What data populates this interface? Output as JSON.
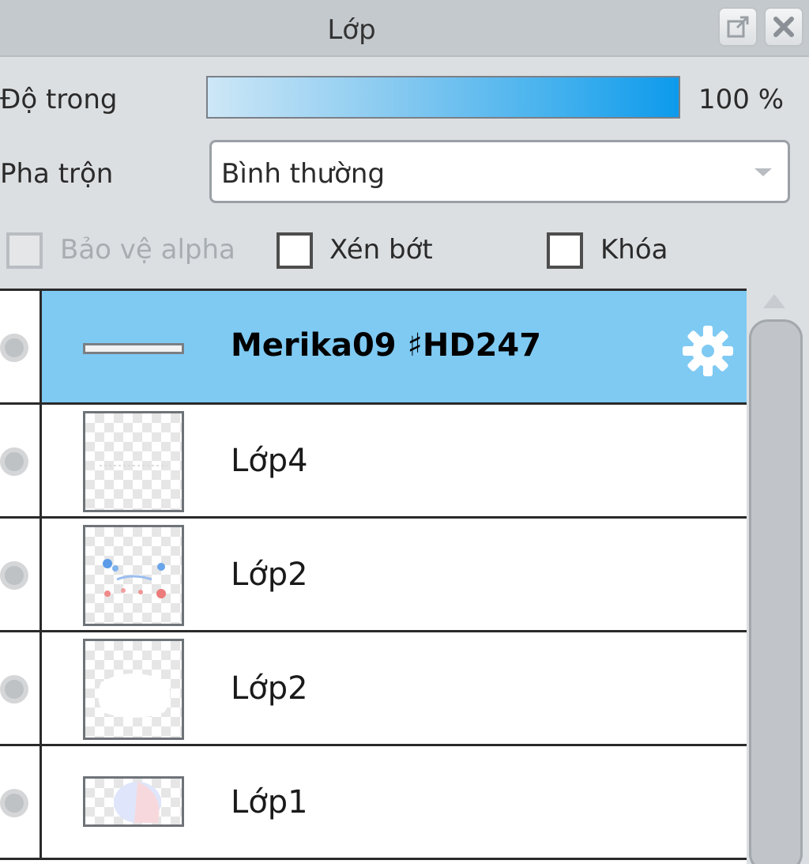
{
  "panel": {
    "title": "Lớp",
    "popout_icon": "popout-icon",
    "close_icon": "close-icon"
  },
  "opacity": {
    "label": "Độ trong",
    "value_text": "100 %",
    "fraction": 1.0
  },
  "blend": {
    "label": "Pha trộn",
    "selected": "Bình thường"
  },
  "options": {
    "protect_alpha": {
      "label": "Bảo vệ alpha",
      "checked": false,
      "disabled": true
    },
    "clip": {
      "label": "Xén bớt",
      "checked": false
    },
    "lock": {
      "label": "Khóa",
      "checked": false
    }
  },
  "layers": [
    {
      "name": "Merika09 ♯HD247",
      "selected": true,
      "gear_icon": "gear-icon"
    },
    {
      "name": "Lớp4",
      "selected": false
    },
    {
      "name": "Lớp2",
      "selected": false
    },
    {
      "name": "Lớp2",
      "selected": false
    },
    {
      "name": "Lớp1",
      "selected": false
    }
  ],
  "colors": {
    "selected_row": "#7fcaf3",
    "opacity_accent": "#0d9aec"
  }
}
